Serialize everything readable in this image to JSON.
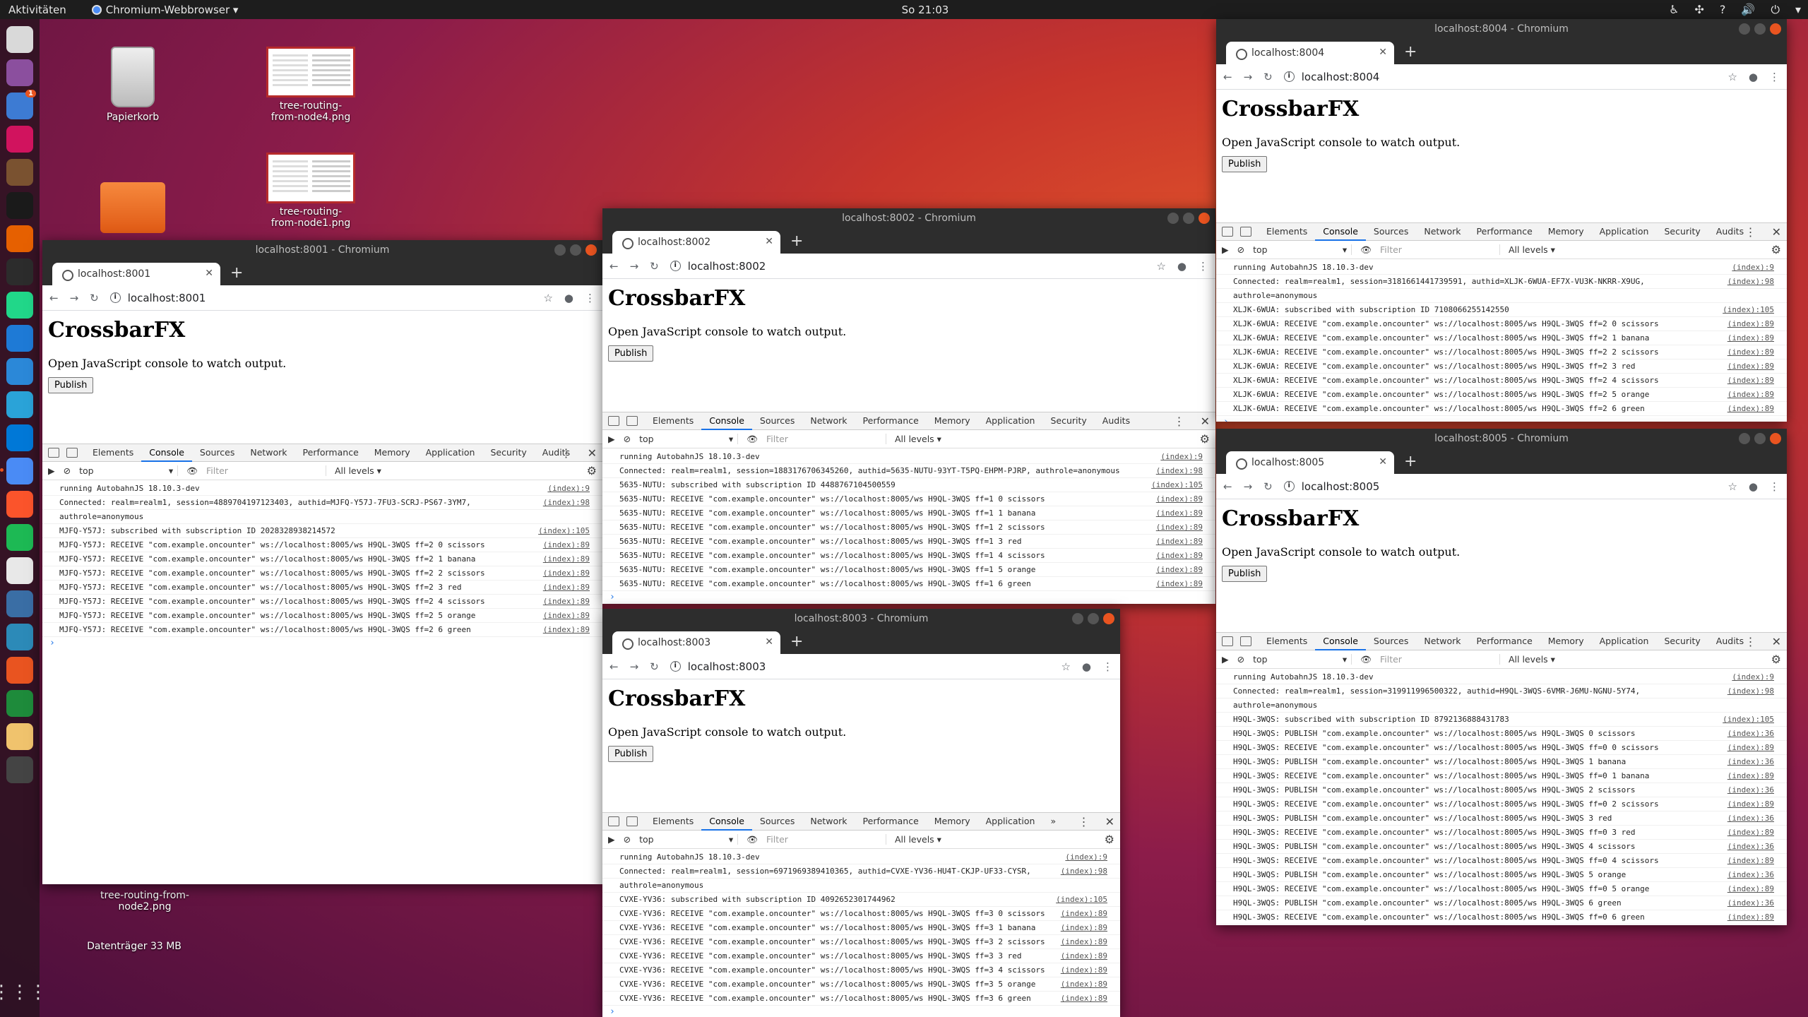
{
  "topbar": {
    "activities": "Aktivitäten",
    "app_menu": "Chromium-Webbrowser ▾",
    "clock": "So 21:03"
  },
  "dock": {
    "badge": "1",
    "icons": [
      {
        "name": "files-icon",
        "color": "#d9d9d9"
      },
      {
        "name": "screenshot-icon",
        "color": "#8b4f9e"
      },
      {
        "name": "thunderbird-icon",
        "color": "#3d7bd3"
      },
      {
        "name": "app-icon",
        "color": "#d1135e"
      },
      {
        "name": "gimp-icon",
        "color": "#7a5230"
      },
      {
        "name": "s-app-icon",
        "color": "#1a1a1a"
      },
      {
        "name": "firefox-icon",
        "color": "#e66000"
      },
      {
        "name": "terminal-icon",
        "color": "#2c2c2c"
      },
      {
        "name": "pycharm-icon",
        "color": "#21d789"
      },
      {
        "name": "vscode-icon",
        "color": "#1e7ad6"
      },
      {
        "name": "chat-icon",
        "color": "#2b88d8"
      },
      {
        "name": "telegram-icon",
        "color": "#2aa3d8"
      },
      {
        "name": "skype-icon",
        "color": "#0078d7"
      },
      {
        "name": "chromium-icon",
        "color": "#4a8bf5"
      },
      {
        "name": "brave-icon",
        "color": "#fb542b"
      },
      {
        "name": "spotify-icon",
        "color": "#1db954"
      },
      {
        "name": "document-icon",
        "color": "#e8e8e8"
      },
      {
        "name": "monitor-icon",
        "color": "#3a6ea5"
      },
      {
        "name": "v-app-icon",
        "color": "#2c8ab8"
      },
      {
        "name": "settings-icon",
        "color": "#e95420"
      },
      {
        "name": "spreadsheet-icon",
        "color": "#1e8b3b"
      },
      {
        "name": "archive-icon",
        "color": "#f0c36d"
      },
      {
        "name": "software-icon",
        "color": "#444444"
      }
    ]
  },
  "desktop": {
    "trash": "Papierkorb",
    "file1": "tree-routing-from-node4.png",
    "file2": "tree-routing-from-node1.png",
    "file3": "tree-routing-from-node2.png",
    "drive": "Datenträger 33 MB"
  },
  "devtools": {
    "elements": "Elements",
    "console": "Console",
    "sources": "Sources",
    "network": "Network",
    "performance": "Performance",
    "memory": "Memory",
    "application": "Application",
    "security": "Security",
    "audits": "Audits",
    "more": "»",
    "context": "top",
    "filter": "Filter",
    "levels": "All levels ▾"
  },
  "page": {
    "heading": "CrossbarFX",
    "text": "Open JavaScript console to watch output.",
    "button": "Publish"
  },
  "windows": [
    {
      "title": "localhost:8001 - Chromium",
      "tab": "localhost:8001",
      "url": "localhost:8001",
      "lines": [
        {
          "msg": "running AutobahnJS 18.10.3-dev",
          "src": "(index):9"
        },
        {
          "msg": "Connected: realm=realm1, session=4889704197123403, authid=MJFQ-Y57J-7FU3-SCRJ-PS67-3YM7,",
          "src": "(index):98"
        },
        {
          "msg": "authrole=anonymous",
          "src": ""
        },
        {
          "msg": "MJFQ-Y57J: subscribed with subscription ID 2028328938214572",
          "src": "(index):105"
        },
        {
          "msg": "MJFQ-Y57J: RECEIVE \"com.example.oncounter\" ws://localhost:8005/ws H9QL-3WQS ff=2 0 scissors",
          "src": "(index):89"
        },
        {
          "msg": "MJFQ-Y57J: RECEIVE \"com.example.oncounter\" ws://localhost:8005/ws H9QL-3WQS ff=2 1 banana",
          "src": "(index):89"
        },
        {
          "msg": "MJFQ-Y57J: RECEIVE \"com.example.oncounter\" ws://localhost:8005/ws H9QL-3WQS ff=2 2 scissors",
          "src": "(index):89"
        },
        {
          "msg": "MJFQ-Y57J: RECEIVE \"com.example.oncounter\" ws://localhost:8005/ws H9QL-3WQS ff=2 3 red",
          "src": "(index):89"
        },
        {
          "msg": "MJFQ-Y57J: RECEIVE \"com.example.oncounter\" ws://localhost:8005/ws H9QL-3WQS ff=2 4 scissors",
          "src": "(index):89"
        },
        {
          "msg": "MJFQ-Y57J: RECEIVE \"com.example.oncounter\" ws://localhost:8005/ws H9QL-3WQS ff=2 5 orange",
          "src": "(index):89"
        },
        {
          "msg": "MJFQ-Y57J: RECEIVE \"com.example.oncounter\" ws://localhost:8005/ws H9QL-3WQS ff=2 6 green",
          "src": "(index):89"
        }
      ]
    },
    {
      "title": "localhost:8002 - Chromium",
      "tab": "localhost:8002",
      "url": "localhost:8002",
      "lines": [
        {
          "msg": "running AutobahnJS 18.10.3-dev",
          "src": "(index):9"
        },
        {
          "msg": "Connected: realm=realm1, session=1883176706345260, authid=5635-NUTU-93YT-T5PQ-EHPM-PJRP, authrole=anonymous",
          "src": "(index):98"
        },
        {
          "msg": "5635-NUTU: subscribed with subscription ID 4488767104500559",
          "src": "(index):105"
        },
        {
          "msg": "5635-NUTU: RECEIVE \"com.example.oncounter\" ws://localhost:8005/ws H9QL-3WQS ff=1 0 scissors",
          "src": "(index):89"
        },
        {
          "msg": "5635-NUTU: RECEIVE \"com.example.oncounter\" ws://localhost:8005/ws H9QL-3WQS ff=1 1 banana",
          "src": "(index):89"
        },
        {
          "msg": "5635-NUTU: RECEIVE \"com.example.oncounter\" ws://localhost:8005/ws H9QL-3WQS ff=1 2 scissors",
          "src": "(index):89"
        },
        {
          "msg": "5635-NUTU: RECEIVE \"com.example.oncounter\" ws://localhost:8005/ws H9QL-3WQS ff=1 3 red",
          "src": "(index):89"
        },
        {
          "msg": "5635-NUTU: RECEIVE \"com.example.oncounter\" ws://localhost:8005/ws H9QL-3WQS ff=1 4 scissors",
          "src": "(index):89"
        },
        {
          "msg": "5635-NUTU: RECEIVE \"com.example.oncounter\" ws://localhost:8005/ws H9QL-3WQS ff=1 5 orange",
          "src": "(index):89"
        },
        {
          "msg": "5635-NUTU: RECEIVE \"com.example.oncounter\" ws://localhost:8005/ws H9QL-3WQS ff=1 6 green",
          "src": "(index):89"
        }
      ]
    },
    {
      "title": "localhost:8003 - Chromium",
      "tab": "localhost:8003",
      "url": "localhost:8003",
      "lines": [
        {
          "msg": "running AutobahnJS 18.10.3-dev",
          "src": "(index):9"
        },
        {
          "msg": "Connected: realm=realm1, session=6971969389410365, authid=CVXE-YV36-HU4T-CKJP-UF33-CYSR,",
          "src": "(index):98"
        },
        {
          "msg": "authrole=anonymous",
          "src": ""
        },
        {
          "msg": "CVXE-YV36: subscribed with subscription ID 4092652301744962",
          "src": "(index):105"
        },
        {
          "msg": "CVXE-YV36: RECEIVE \"com.example.oncounter\" ws://localhost:8005/ws H9QL-3WQS ff=3 0 scissors",
          "src": "(index):89"
        },
        {
          "msg": "CVXE-YV36: RECEIVE \"com.example.oncounter\" ws://localhost:8005/ws H9QL-3WQS ff=3 1 banana",
          "src": "(index):89"
        },
        {
          "msg": "CVXE-YV36: RECEIVE \"com.example.oncounter\" ws://localhost:8005/ws H9QL-3WQS ff=3 2 scissors",
          "src": "(index):89"
        },
        {
          "msg": "CVXE-YV36: RECEIVE \"com.example.oncounter\" ws://localhost:8005/ws H9QL-3WQS ff=3 3 red",
          "src": "(index):89"
        },
        {
          "msg": "CVXE-YV36: RECEIVE \"com.example.oncounter\" ws://localhost:8005/ws H9QL-3WQS ff=3 4 scissors",
          "src": "(index):89"
        },
        {
          "msg": "CVXE-YV36: RECEIVE \"com.example.oncounter\" ws://localhost:8005/ws H9QL-3WQS ff=3 5 orange",
          "src": "(index):89"
        },
        {
          "msg": "CVXE-YV36: RECEIVE \"com.example.oncounter\" ws://localhost:8005/ws H9QL-3WQS ff=3 6 green",
          "src": "(index):89"
        }
      ]
    },
    {
      "title": "localhost:8004 - Chromium",
      "tab": "localhost:8004",
      "url": "localhost:8004",
      "lines": [
        {
          "msg": "running AutobahnJS 18.10.3-dev",
          "src": "(index):9"
        },
        {
          "msg": "Connected: realm=realm1, session=3181661441739591, authid=XLJK-6WUA-EF7X-VU3K-NKRR-X9UG,",
          "src": "(index):98"
        },
        {
          "msg": "authrole=anonymous",
          "src": ""
        },
        {
          "msg": "XLJK-6WUA: subscribed with subscription ID 7108066255142550",
          "src": "(index):105"
        },
        {
          "msg": "XLJK-6WUA: RECEIVE \"com.example.oncounter\" ws://localhost:8005/ws H9QL-3WQS ff=2 0 scissors",
          "src": "(index):89"
        },
        {
          "msg": "XLJK-6WUA: RECEIVE \"com.example.oncounter\" ws://localhost:8005/ws H9QL-3WQS ff=2 1 banana",
          "src": "(index):89"
        },
        {
          "msg": "XLJK-6WUA: RECEIVE \"com.example.oncounter\" ws://localhost:8005/ws H9QL-3WQS ff=2 2 scissors",
          "src": "(index):89"
        },
        {
          "msg": "XLJK-6WUA: RECEIVE \"com.example.oncounter\" ws://localhost:8005/ws H9QL-3WQS ff=2 3 red",
          "src": "(index):89"
        },
        {
          "msg": "XLJK-6WUA: RECEIVE \"com.example.oncounter\" ws://localhost:8005/ws H9QL-3WQS ff=2 4 scissors",
          "src": "(index):89"
        },
        {
          "msg": "XLJK-6WUA: RECEIVE \"com.example.oncounter\" ws://localhost:8005/ws H9QL-3WQS ff=2 5 orange",
          "src": "(index):89"
        },
        {
          "msg": "XLJK-6WUA: RECEIVE \"com.example.oncounter\" ws://localhost:8005/ws H9QL-3WQS ff=2 6 green",
          "src": "(index):89"
        }
      ]
    },
    {
      "title": "localhost:8005 - Chromium",
      "tab": "localhost:8005",
      "url": "localhost:8005",
      "lines": [
        {
          "msg": "running AutobahnJS 18.10.3-dev",
          "src": "(index):9"
        },
        {
          "msg": "Connected: realm=realm1, session=319911996500322, authid=H9QL-3WQS-6VMR-J6MU-NGNU-5Y74,",
          "src": "(index):98"
        },
        {
          "msg": "authrole=anonymous",
          "src": ""
        },
        {
          "msg": "H9QL-3WQS: subscribed with subscription ID 8792136888431783",
          "src": "(index):105"
        },
        {
          "msg": "H9QL-3WQS: PUBLISH \"com.example.oncounter\" ws://localhost:8005/ws H9QL-3WQS     0 scissors",
          "src": "(index):36"
        },
        {
          "msg": "H9QL-3WQS: RECEIVE \"com.example.oncounter\" ws://localhost:8005/ws H9QL-3WQS ff=0 0 scissors",
          "src": "(index):89"
        },
        {
          "msg": "H9QL-3WQS: PUBLISH \"com.example.oncounter\" ws://localhost:8005/ws H9QL-3WQS     1 banana",
          "src": "(index):36"
        },
        {
          "msg": "H9QL-3WQS: RECEIVE \"com.example.oncounter\" ws://localhost:8005/ws H9QL-3WQS ff=0 1 banana",
          "src": "(index):89"
        },
        {
          "msg": "H9QL-3WQS: PUBLISH \"com.example.oncounter\" ws://localhost:8005/ws H9QL-3WQS     2 scissors",
          "src": "(index):36"
        },
        {
          "msg": "H9QL-3WQS: RECEIVE \"com.example.oncounter\" ws://localhost:8005/ws H9QL-3WQS ff=0 2 scissors",
          "src": "(index):89"
        },
        {
          "msg": "H9QL-3WQS: PUBLISH \"com.example.oncounter\" ws://localhost:8005/ws H9QL-3WQS     3 red",
          "src": "(index):36"
        },
        {
          "msg": "H9QL-3WQS: RECEIVE \"com.example.oncounter\" ws://localhost:8005/ws H9QL-3WQS ff=0 3 red",
          "src": "(index):89"
        },
        {
          "msg": "H9QL-3WQS: PUBLISH \"com.example.oncounter\" ws://localhost:8005/ws H9QL-3WQS     4 scissors",
          "src": "(index):36"
        },
        {
          "msg": "H9QL-3WQS: RECEIVE \"com.example.oncounter\" ws://localhost:8005/ws H9QL-3WQS ff=0 4 scissors",
          "src": "(index):89"
        },
        {
          "msg": "H9QL-3WQS: PUBLISH \"com.example.oncounter\" ws://localhost:8005/ws H9QL-3WQS     5 orange",
          "src": "(index):36"
        },
        {
          "msg": "H9QL-3WQS: RECEIVE \"com.example.oncounter\" ws://localhost:8005/ws H9QL-3WQS ff=0 5 orange",
          "src": "(index):89"
        },
        {
          "msg": "H9QL-3WQS: PUBLISH \"com.example.oncounter\" ws://localhost:8005/ws H9QL-3WQS     6 green",
          "src": "(index):36"
        },
        {
          "msg": "H9QL-3WQS: RECEIVE \"com.example.oncounter\" ws://localhost:8005/ws H9QL-3WQS ff=0 6 green",
          "src": "(index):89"
        }
      ]
    }
  ]
}
